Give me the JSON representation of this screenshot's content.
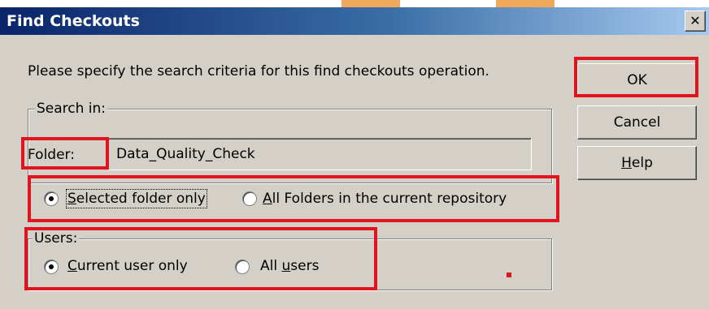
{
  "dialog": {
    "title": "Find Checkouts",
    "close_glyph": "✕",
    "instruction": "Please specify the search criteria for this find checkouts operation."
  },
  "search_in": {
    "legend": "Search in:",
    "folder_label": "Folder:",
    "folder_value": "Data_Quality_Check",
    "options": [
      {
        "label": "Selected folder only",
        "selected": true
      },
      {
        "label": "All Folders in the current repository",
        "selected": false
      }
    ]
  },
  "users": {
    "legend": "Users:",
    "options": [
      {
        "label": "Current user only",
        "selected": true
      },
      {
        "label": "All users",
        "selected": false
      }
    ]
  },
  "buttons": {
    "ok": "OK",
    "cancel": "Cancel",
    "help": "Help"
  },
  "colors": {
    "highlight_red": "#e0141e",
    "titlebar_start": "#0a246a",
    "face": "#d4d0c8"
  }
}
